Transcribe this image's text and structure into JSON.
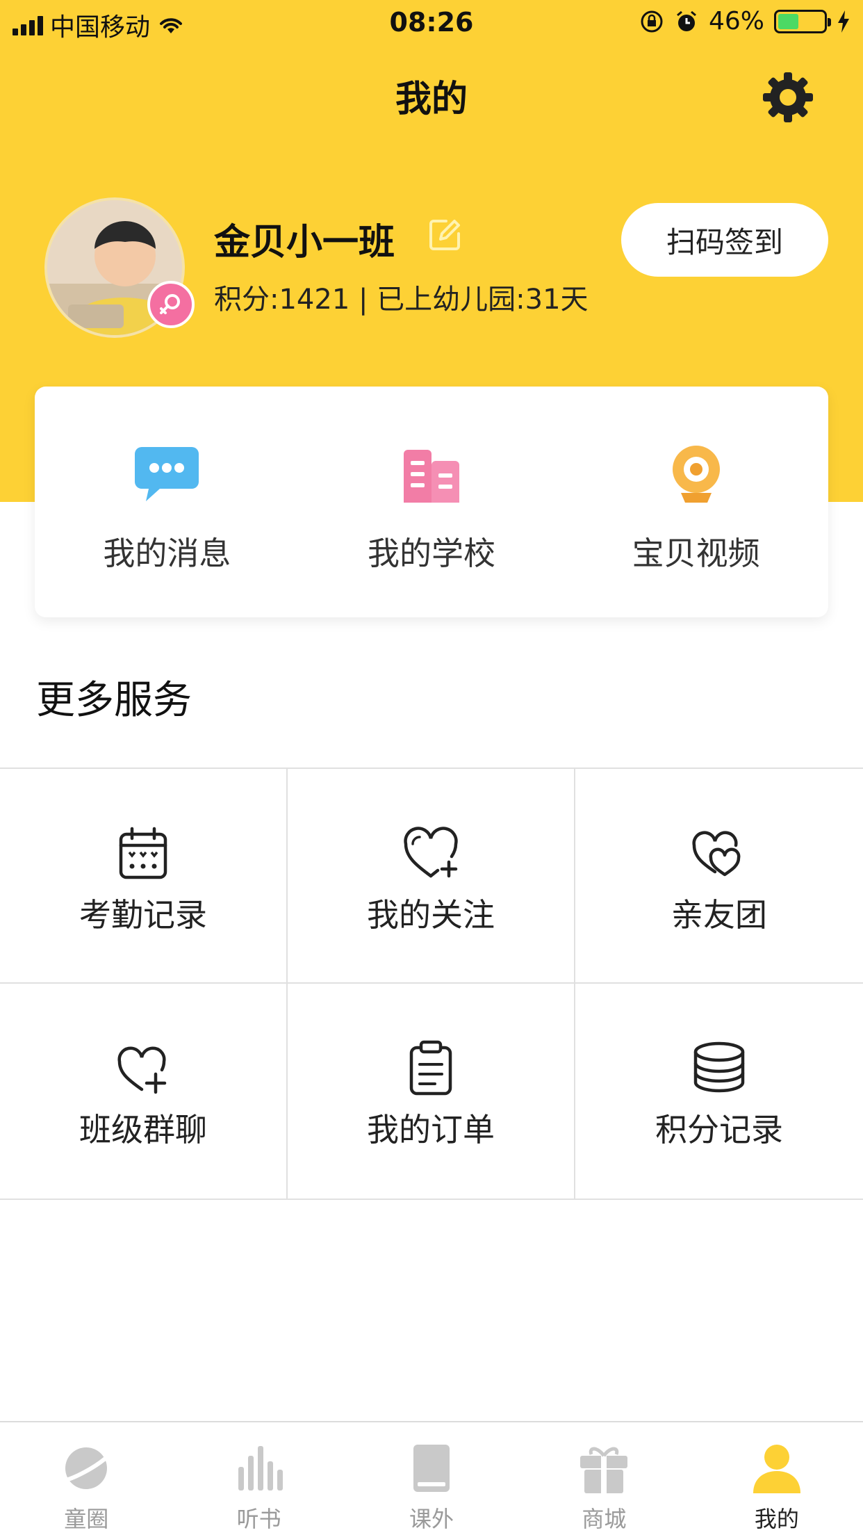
{
  "status_bar": {
    "carrier": "中国移动",
    "time": "08:26",
    "battery": "46%",
    "battery_level": 0.46
  },
  "header": {
    "title": "我的"
  },
  "profile": {
    "name": "金贝小一班",
    "stats": "积分:1421 | 已上幼儿园:31天",
    "scan_button": "扫码签到"
  },
  "quick_actions": [
    {
      "label": "我的消息",
      "icon": "message-bubble-icon"
    },
    {
      "label": "我的学校",
      "icon": "school-building-icon"
    },
    {
      "label": "宝贝视频",
      "icon": "camera-icon"
    }
  ],
  "services": {
    "title": "更多服务",
    "items": [
      {
        "label": "考勤记录",
        "icon": "calendar-icon"
      },
      {
        "label": "我的关注",
        "icon": "heart-plus-icon"
      },
      {
        "label": "亲友团",
        "icon": "double-heart-icon"
      },
      {
        "label": "班级群聊",
        "icon": "heart-add-icon"
      },
      {
        "label": "我的订单",
        "icon": "clipboard-icon"
      },
      {
        "label": "积分记录",
        "icon": "coin-stack-icon"
      }
    ]
  },
  "tab_bar": {
    "items": [
      {
        "label": "童圈",
        "icon": "planet-icon",
        "active": false
      },
      {
        "label": "听书",
        "icon": "audio-bars-icon",
        "active": false
      },
      {
        "label": "课外",
        "icon": "book-icon",
        "active": false
      },
      {
        "label": "商城",
        "icon": "gift-icon",
        "active": false
      },
      {
        "label": "我的",
        "icon": "person-icon",
        "active": true
      }
    ]
  },
  "colors": {
    "brand_yellow": "#FDD135",
    "active_tab": "#FDD135",
    "inactive_tab": "#C9C9C9"
  }
}
